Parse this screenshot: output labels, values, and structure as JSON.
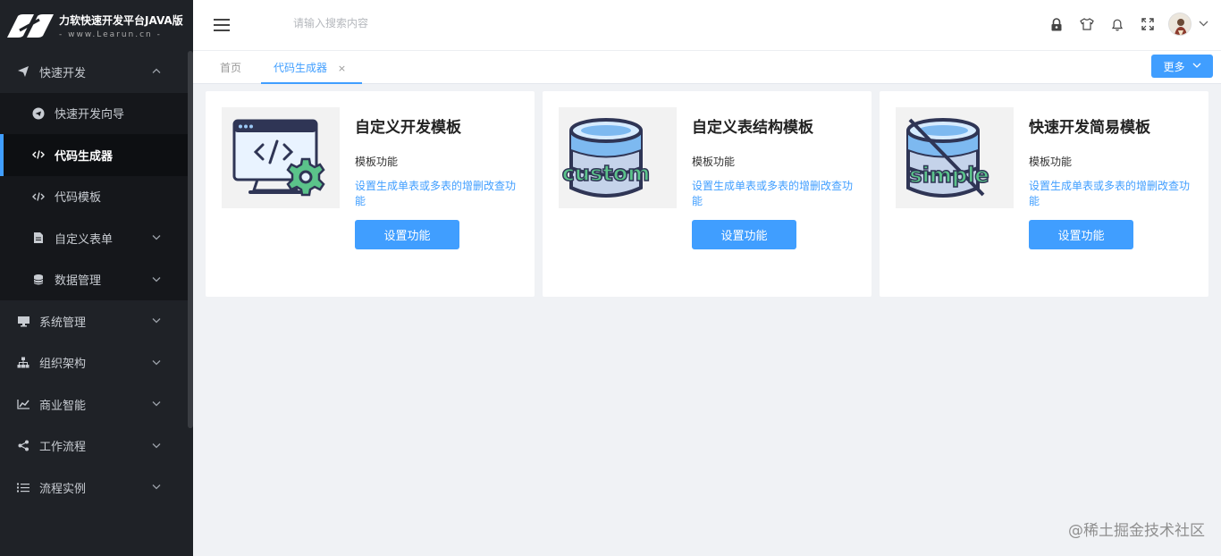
{
  "brand": {
    "title": "力软快速开发平台JAVA版",
    "subtitle": "- www.Learun.cn -"
  },
  "sidebar": {
    "items": [
      {
        "label": "快速开发",
        "icon": "paper-plane-icon",
        "arrow": "up"
      },
      {
        "label": "快速开发向导",
        "icon": "telegram-icon",
        "sub": true
      },
      {
        "label": "代码生成器",
        "icon": "code-icon",
        "sub": true,
        "active": true
      },
      {
        "label": "代码模板",
        "icon": "code-icon",
        "sub": true
      },
      {
        "label": "自定义表单",
        "icon": "file-icon",
        "sub": true,
        "arrow": "down"
      },
      {
        "label": "数据管理",
        "icon": "database-icon",
        "sub": true,
        "arrow": "down"
      },
      {
        "label": "系统管理",
        "icon": "monitor-icon",
        "arrow": "down"
      },
      {
        "label": "组织架构",
        "icon": "sitemap-icon",
        "arrow": "down"
      },
      {
        "label": "商业智能",
        "icon": "line-chart-icon",
        "arrow": "down"
      },
      {
        "label": "工作流程",
        "icon": "share-icon",
        "arrow": "down"
      },
      {
        "label": "流程实例",
        "icon": "list-icon",
        "arrow": "down"
      }
    ]
  },
  "header": {
    "search_placeholder": "请输入搜索内容"
  },
  "tabs": {
    "home": "首页",
    "active": "代码生成器",
    "close": "×",
    "more": "更多"
  },
  "cards": [
    {
      "title": "自定义开发模板",
      "label": "模板功能",
      "desc": "设置生成单表或多表的增删改查功能",
      "button": "设置功能",
      "thumb": "code-gear-icon"
    },
    {
      "title": "自定义表结构模板",
      "label": "模板功能",
      "desc": "设置生成单表或多表的增删改查功能",
      "button": "设置功能",
      "thumb": "database-custom-icon",
      "thumb_text": "custom"
    },
    {
      "title": "快速开发简易模板",
      "label": "模板功能",
      "desc": "设置生成单表或多表的增删改查功能",
      "button": "设置功能",
      "thumb": "database-simple-icon",
      "thumb_text": "simple"
    }
  ],
  "watermark": "@稀土掘金技术社区",
  "colors": {
    "accent": "#409eff",
    "sidebar_bg": "#1f2227"
  }
}
